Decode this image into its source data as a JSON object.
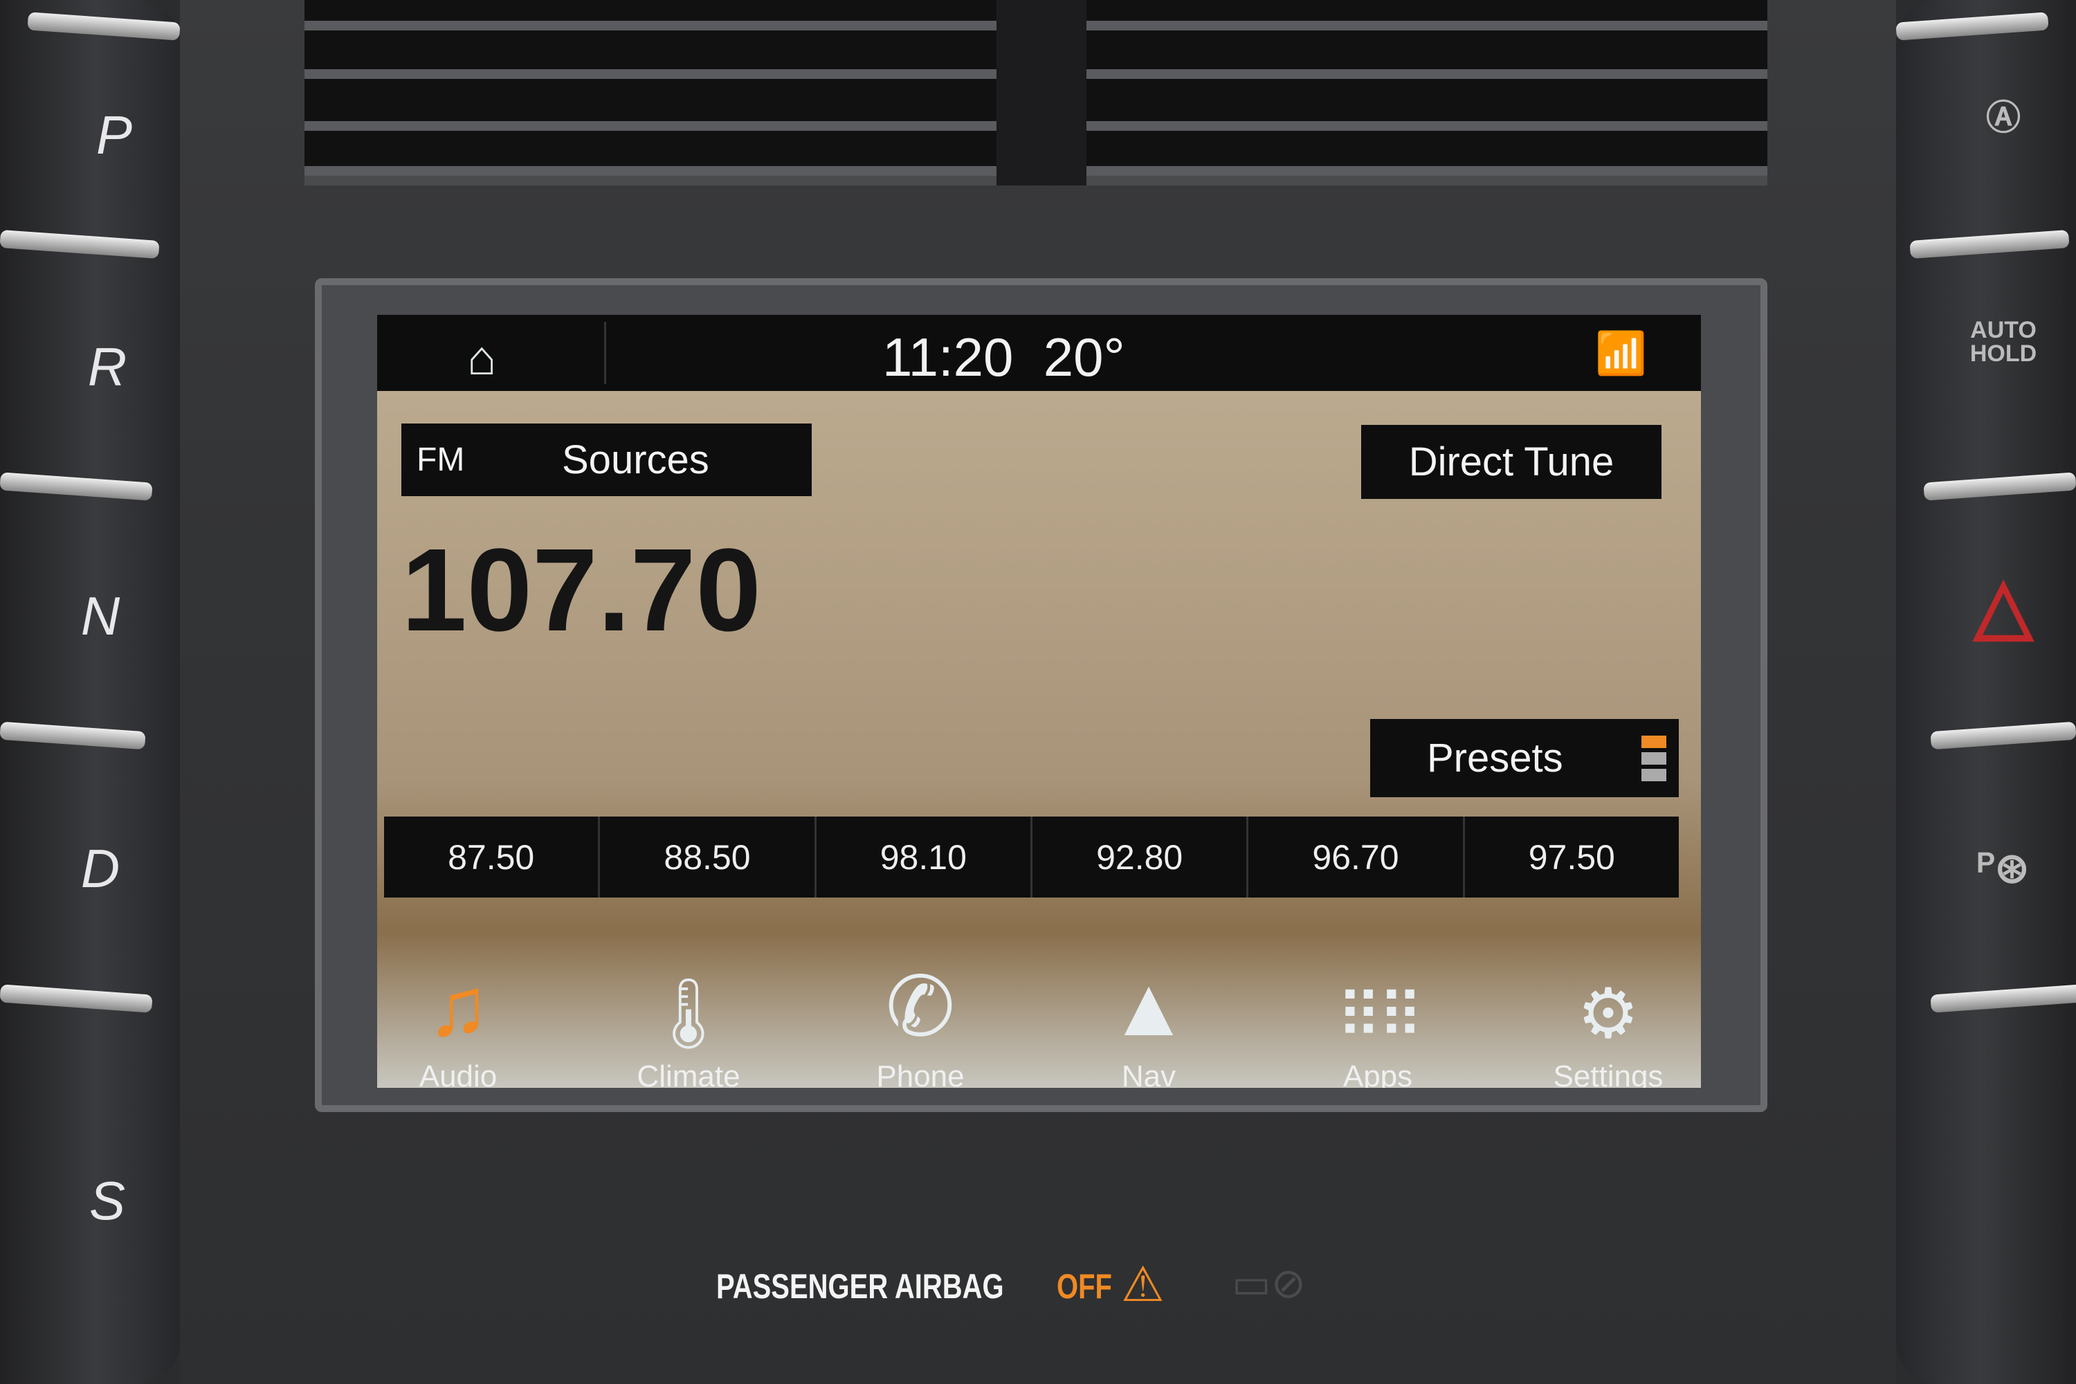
{
  "status_bar": {
    "time": "11:20",
    "temperature": "20°",
    "home_icon": "home-icon",
    "wifi_icon": "wifi-info-icon"
  },
  "source": {
    "band": "FM",
    "sources_label": "Sources",
    "direct_tune_label": "Direct Tune"
  },
  "frequency": "107.70",
  "presets": {
    "label": "Presets",
    "stations": [
      "87.50",
      "88.50",
      "98.10",
      "92.80",
      "96.70",
      "97.50"
    ]
  },
  "dock": [
    {
      "label": "Audio",
      "icon": "music-note-icon",
      "color": "#f08a24"
    },
    {
      "label": "Climate",
      "icon": "thermometer-icon"
    },
    {
      "label": "Phone",
      "icon": "phone-icon"
    },
    {
      "label": "Nav",
      "icon": "navigation-arrow-icon"
    },
    {
      "label": "Apps",
      "icon": "apps-grid-icon"
    },
    {
      "label": "Settings",
      "icon": "gears-icon"
    }
  ],
  "gear_selector": [
    "P",
    "R",
    "N",
    "D",
    "S"
  ],
  "right_buttons": {
    "auto_hold": "AUTO HOLD",
    "auto_hold_line2": "HOLD",
    "auto_hold_line1": "AUTO"
  },
  "airbag": {
    "label": "PASSENGER AIRBAG",
    "status": "OFF",
    "status_color": "#f08a24"
  },
  "colors": {
    "accent": "#f08a24",
    "screen_bg": "#b3a085",
    "button_bg": "#0e0e0e"
  }
}
